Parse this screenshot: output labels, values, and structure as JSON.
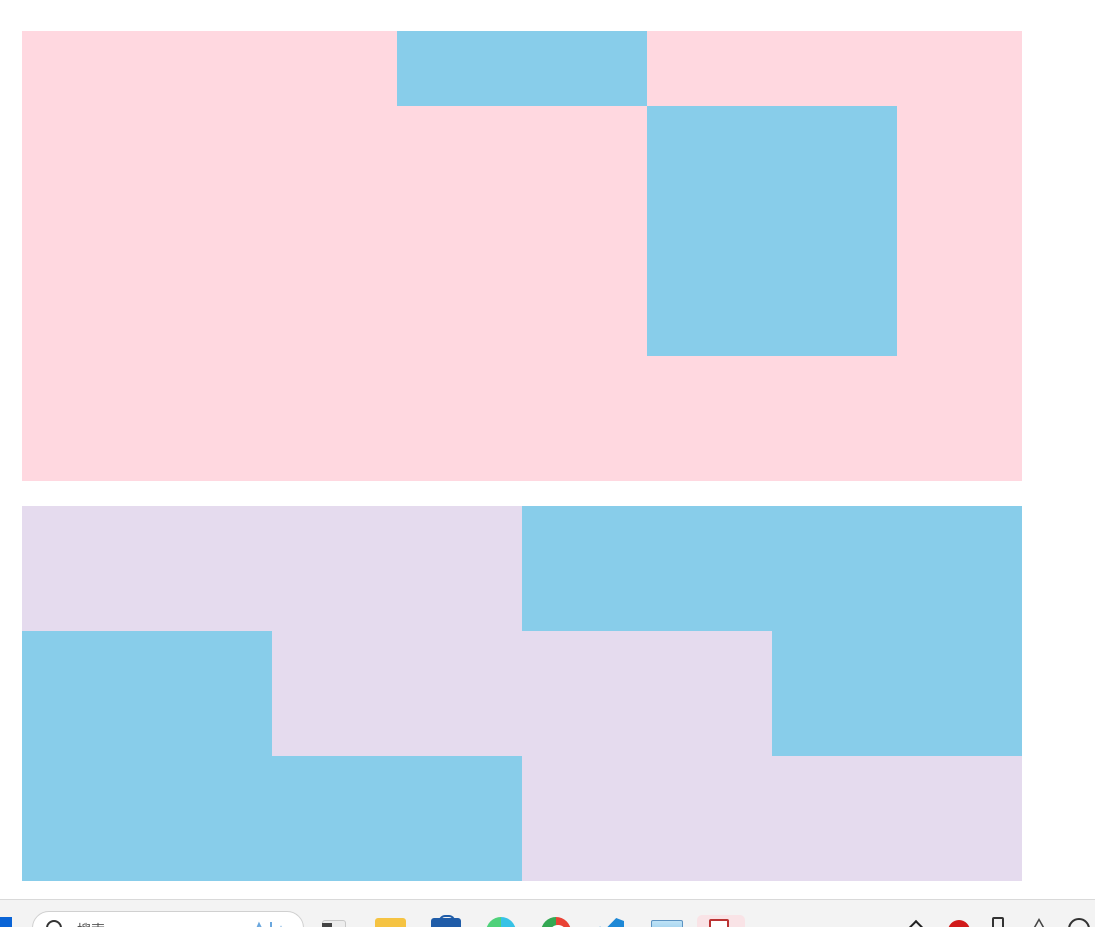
{
  "colors": {
    "page_background": "#ffffff",
    "top_panel": "#ffd8e0",
    "bottom_panel": "#e5dbee",
    "block": "#88cdea",
    "taskbar": "#f3f3f3"
  },
  "taskbar": {
    "search": {
      "placeholder": "搜索",
      "icon": "search-icon"
    },
    "apps": [
      {
        "name": "task-view",
        "icon": "task-view-icon"
      },
      {
        "name": "file-explorer",
        "icon": "folder-icon"
      },
      {
        "name": "microsoft-store",
        "icon": "store-bag-icon"
      },
      {
        "name": "edge",
        "icon": "edge-icon"
      },
      {
        "name": "chrome",
        "icon": "chrome-icon"
      },
      {
        "name": "vscode",
        "icon": "vscode-icon"
      },
      {
        "name": "photos",
        "icon": "photos-icon"
      },
      {
        "name": "active-app",
        "icon": "document-app-icon"
      }
    ],
    "tray": [
      {
        "name": "hidden-icons",
        "icon": "chevron-up-icon"
      },
      {
        "name": "red-app",
        "icon": "red-circle-app-icon"
      },
      {
        "name": "usb",
        "icon": "usb-icon"
      },
      {
        "name": "notice",
        "icon": "triangle-warning-icon"
      },
      {
        "name": "network",
        "icon": "wifi-icon"
      }
    ]
  }
}
